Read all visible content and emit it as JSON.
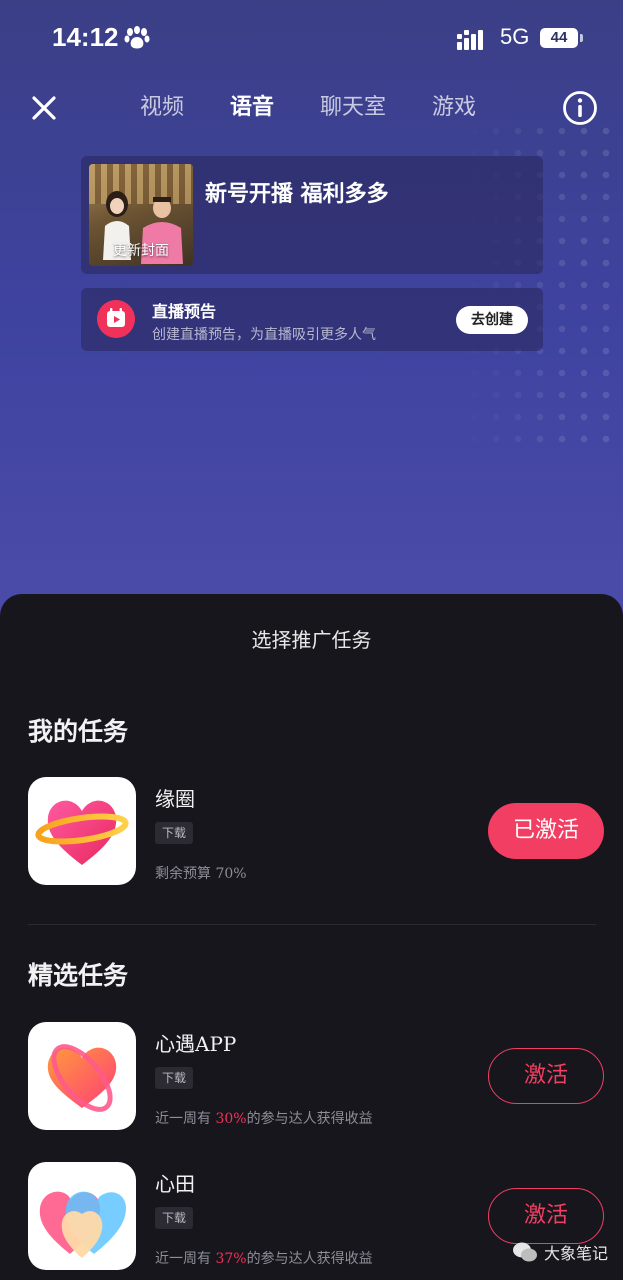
{
  "status_bar": {
    "time": "14:12",
    "network": "5G",
    "battery": "44"
  },
  "nav": {
    "tabs": [
      "视频",
      "语音",
      "聊天室",
      "游戏"
    ],
    "active_tab": "语音"
  },
  "cover": {
    "thumb_label": "更新封面",
    "title": "新号开播 福利多多"
  },
  "preview": {
    "title": "直播预告",
    "subtitle": "创建直播预告，为直播吸引更多人气",
    "button": "去创建"
  },
  "sheet": {
    "title": "选择推广任务",
    "my_tasks_title": "我的任务",
    "featured_title": "精选任务",
    "my_tasks": [
      {
        "name": "缘圈",
        "tag": "下载",
        "meta": "剩余预算 70%",
        "button": "已激活"
      }
    ],
    "featured": [
      {
        "name": "心遇APP",
        "tag": "下载",
        "meta_pre": "近一周有 ",
        "meta_pct": "30%",
        "meta_post": "的参与达人获得收益",
        "button": "激活"
      },
      {
        "name": "心田",
        "tag": "下载",
        "meta_pre": "近一周有 ",
        "meta_pct": "37%",
        "meta_post": "的参与达人获得收益",
        "button": "激活"
      }
    ]
  },
  "watermark": "大象笔记",
  "colors": {
    "accent": "#f23e63",
    "sheet_bg": "#17161c",
    "top_bg": "#3f43a0"
  }
}
